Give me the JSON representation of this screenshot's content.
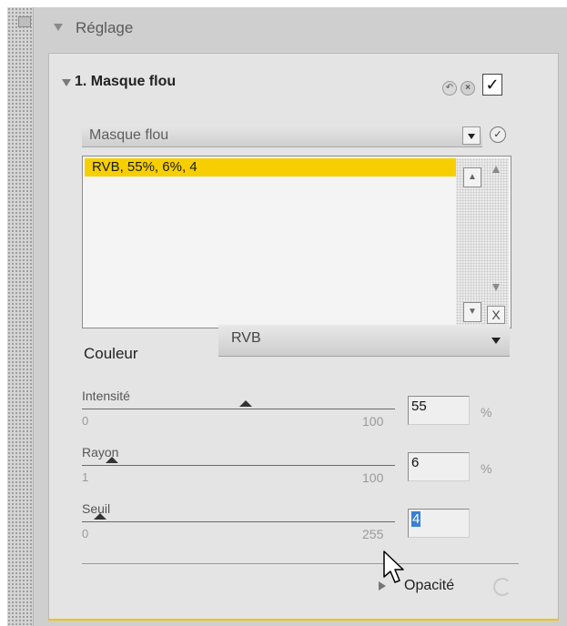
{
  "section": {
    "title": "Réglage"
  },
  "panel": {
    "title": "1. Masque flou",
    "enabled_mark": "✓"
  },
  "preset": {
    "selected": "Masque flou"
  },
  "history_list": {
    "items": [
      "RVB, 55%, 6%, 4"
    ],
    "remove_label": "X"
  },
  "color": {
    "label": "Couleur",
    "selected": "RVB"
  },
  "sliders": [
    {
      "label": "Intensité",
      "min": "0",
      "max": "100",
      "value": "55",
      "unit": "%",
      "level": 0.55
    },
    {
      "label": "Rayon",
      "min": "1",
      "max": "100",
      "value": "6",
      "unit": "%",
      "level": 0.06
    },
    {
      "label": "Seuil",
      "min": "0",
      "max": "255",
      "value": "4",
      "unit": "",
      "level": 0.016
    }
  ],
  "opacity": {
    "label": "Opacité"
  },
  "colors": {
    "highlight": "#f7cf00",
    "selection": "#3a7fd6"
  },
  "icons": {
    "reset": "undo-icon",
    "delete": "close-icon",
    "apply": "apply-check-icon",
    "cursor": "mouse-pointer-icon"
  }
}
